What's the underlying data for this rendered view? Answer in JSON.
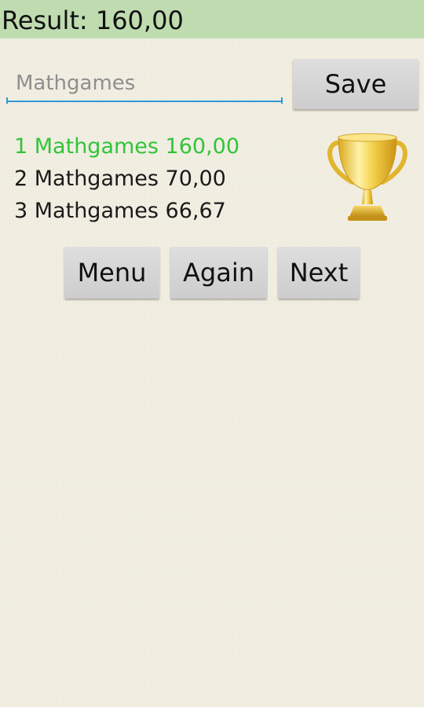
{
  "header": {
    "result_text": "Result: 160,00",
    "bar_color": "#bfdcb1"
  },
  "name_entry": {
    "placeholder": "Mathgames",
    "value": "",
    "save_label": "Save",
    "underline_color": "#2f98d6"
  },
  "leaderboard": {
    "highlight_color": "#32c43a",
    "entries": [
      {
        "rank": "1",
        "name": "Mathgames",
        "score": "160,00",
        "text": "1 Mathgames 160,00"
      },
      {
        "rank": "2",
        "name": "Mathgames",
        "score": "70,00",
        "text": "2 Mathgames 70,00"
      },
      {
        "rank": "3",
        "name": "Mathgames",
        "score": "66,67",
        "text": "3 Mathgames 66,67"
      }
    ],
    "icon": "trophy-icon"
  },
  "actions": {
    "menu_label": "Menu",
    "again_label": "Again",
    "next_label": "Next"
  }
}
